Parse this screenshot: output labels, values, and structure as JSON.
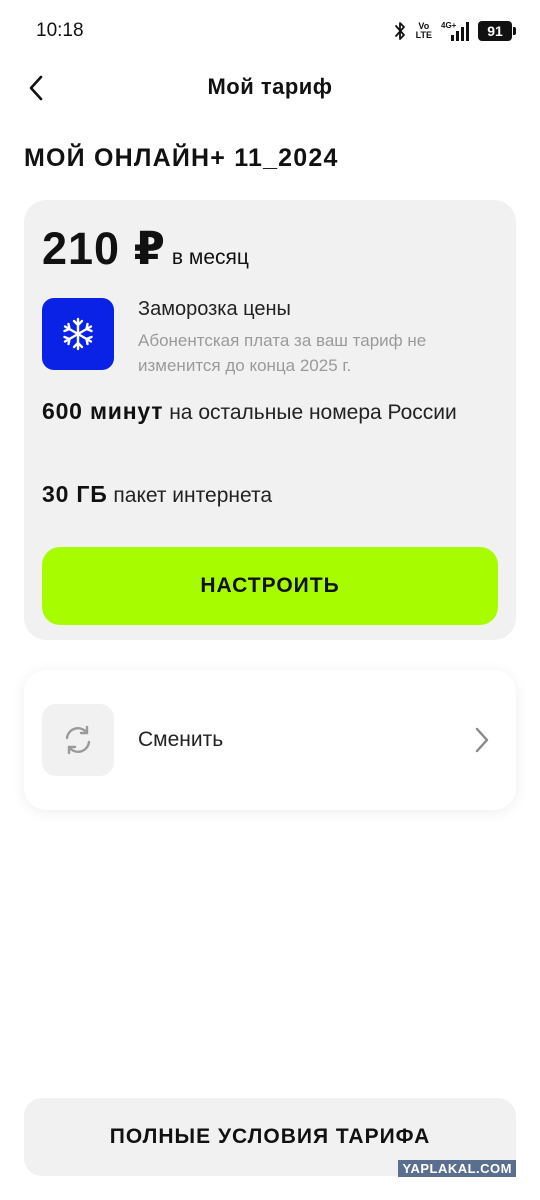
{
  "status_bar": {
    "time": "10:18",
    "volte_top": "Vo",
    "volte_bottom": "LTE",
    "network": "4G+",
    "battery": "91"
  },
  "header": {
    "title": "Мой тариф",
    "back_icon": "chevron-left-icon"
  },
  "tariff": {
    "name": "МОЙ ОНЛАЙН+ 11_2024",
    "price": "210 ₽",
    "period": "в месяц",
    "freeze": {
      "icon": "snowflake-icon",
      "title": "Заморозка цены",
      "description": "Абонентская плата за ваш тариф не изменится до конца 2025 г."
    },
    "minutes": {
      "value": "600 минут",
      "text": "на остальные номера России"
    },
    "internet": {
      "value": "30 ГБ",
      "text": "пакет интернета"
    },
    "configure_label": "НАСТРОИТЬ"
  },
  "change": {
    "icon": "refresh-icon",
    "label": "Сменить"
  },
  "footer": {
    "full_terms_label": "ПОЛНЫЕ УСЛОВИЯ ТАРИФА"
  },
  "watermark": "YAPLAKAL.COM",
  "colors": {
    "accent_green": "#a7fc00",
    "freeze_blue": "#0a22e6",
    "card_gray": "#f1f1f1"
  }
}
